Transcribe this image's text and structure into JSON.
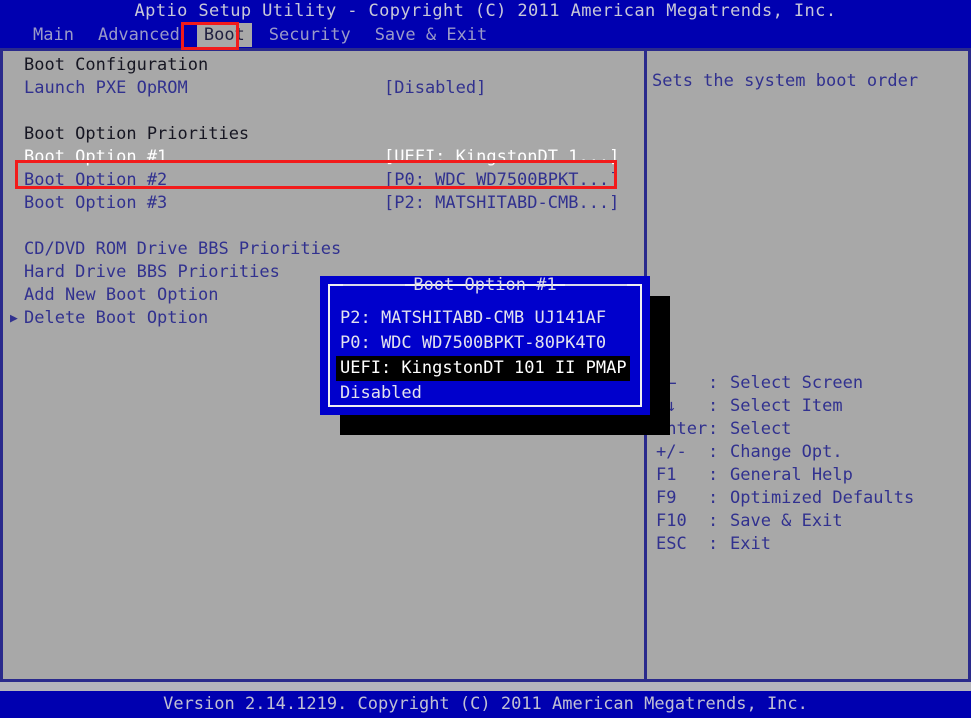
{
  "window": {
    "title": "Aptio Setup Utility - Copyright (C) 2011 American Megatrends, Inc.",
    "footer": "Version 2.14.1219. Copyright (C) 2011 American Megatrends, Inc."
  },
  "menubar": {
    "items": [
      {
        "label": "Main",
        "active": false
      },
      {
        "label": "Advanced",
        "active": false
      },
      {
        "label": "Boot",
        "active": true
      },
      {
        "label": "Security",
        "active": false
      },
      {
        "label": "Save & Exit",
        "active": false
      }
    ]
  },
  "settings": {
    "rows": [
      {
        "type": "header",
        "label": "Boot Configuration",
        "value": ""
      },
      {
        "type": "option",
        "label": "Launch PXE OpROM",
        "value": "[Disabled]"
      },
      {
        "type": "spacer",
        "label": "",
        "value": ""
      },
      {
        "type": "header",
        "label": "Boot Option Priorities",
        "value": ""
      },
      {
        "type": "selected",
        "label": "Boot Option #1",
        "value": "[UEFI: KingstonDT 1...]"
      },
      {
        "type": "option",
        "label": "Boot Option #2",
        "value": "[P0: WDC WD7500BPKT...]"
      },
      {
        "type": "option",
        "label": "Boot Option #3",
        "value": "[P2: MATSHITABD-CMB...]"
      },
      {
        "type": "spacer",
        "label": "",
        "value": ""
      },
      {
        "type": "submenu",
        "label": "CD/DVD ROM Drive BBS Priorities",
        "value": "",
        "marker": ""
      },
      {
        "type": "submenu",
        "label": "Hard Drive BBS Priorities",
        "value": "",
        "marker": ""
      },
      {
        "type": "submenu",
        "label": "Add New Boot Option",
        "value": "",
        "marker": ""
      },
      {
        "type": "submenu",
        "label": "Delete Boot Option",
        "value": "",
        "marker": "▶"
      }
    ]
  },
  "help": {
    "text": "Sets the system boot order"
  },
  "legend": {
    "rows": [
      {
        "key": "→←",
        "sep": ":",
        "action": "Select Screen"
      },
      {
        "key": "↑↓",
        "sep": ":",
        "action": "Select Item"
      },
      {
        "key": "Enter",
        "sep": ":",
        "action": "Select"
      },
      {
        "key": "+/-",
        "sep": ":",
        "action": "Change Opt."
      },
      {
        "key": "F1",
        "sep": ":",
        "action": "General Help"
      },
      {
        "key": "F9",
        "sep": ":",
        "action": "Optimized Defaults"
      },
      {
        "key": "F10",
        "sep": ":",
        "action": "Save & Exit"
      },
      {
        "key": "ESC",
        "sep": ":",
        "action": "Exit"
      }
    ]
  },
  "popup": {
    "title": "Boot Option #1",
    "items": [
      {
        "label": "P2: MATSHITABD-CMB UJ141AF",
        "selected": false
      },
      {
        "label": "P0: WDC WD7500BPKT-80PK4T0",
        "selected": false
      },
      {
        "label": "UEFI: KingstonDT 101 II PMAP",
        "selected": true
      },
      {
        "label": "Disabled",
        "selected": false
      }
    ]
  },
  "annotations": {
    "color": "#f21b1b",
    "boot_tab_highlight": "Boot",
    "boot_option_1_highlight": "Boot Option #1"
  }
}
